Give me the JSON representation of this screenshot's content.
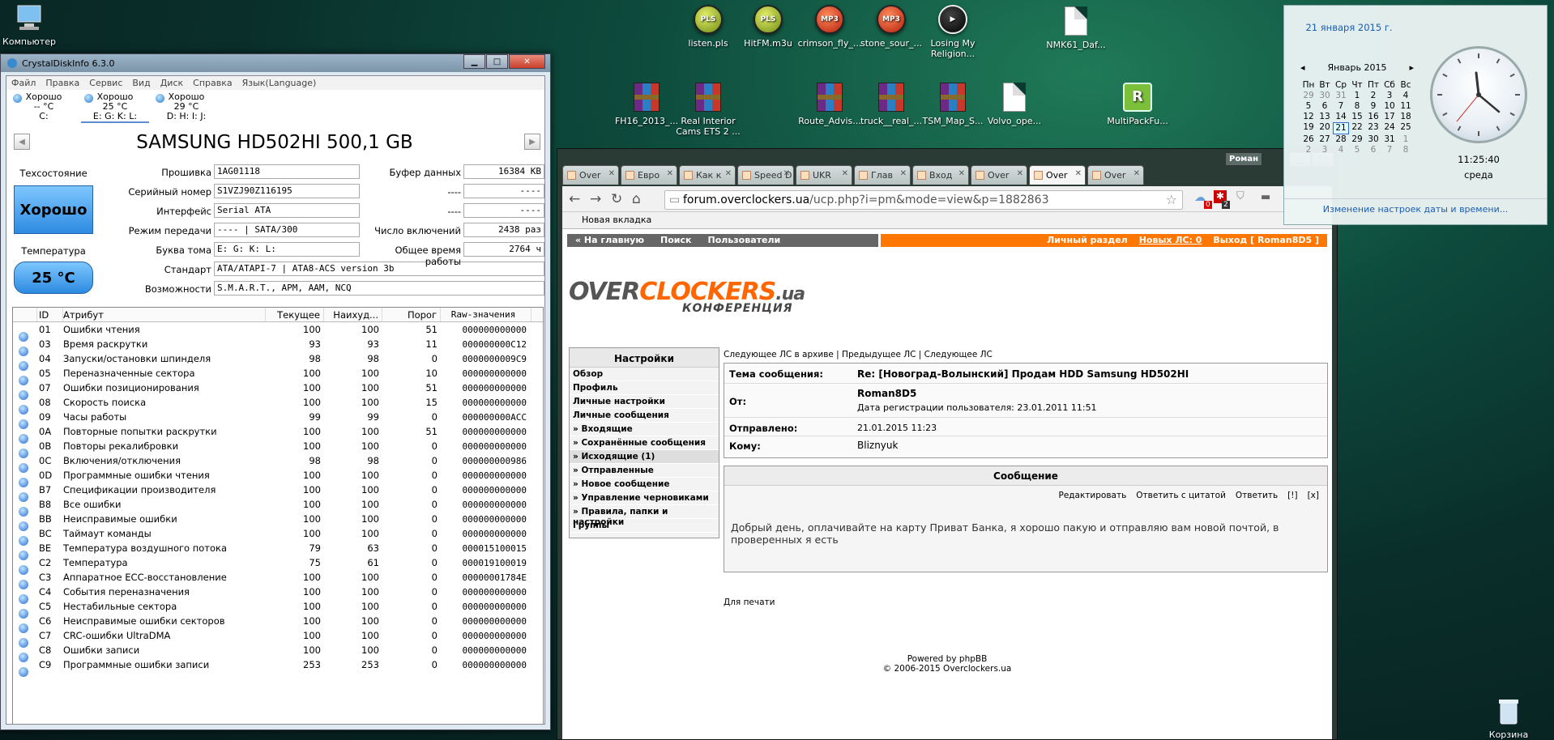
{
  "desktop_icons": [
    {
      "label": "Компьютер",
      "kind": "computer"
    },
    {
      "label": "listen.pls",
      "kind": "pls"
    },
    {
      "label": "HitFM.m3u",
      "kind": "pls"
    },
    {
      "label": "crimson_fly_...",
      "kind": "mp3"
    },
    {
      "label": "stone_sour_...",
      "kind": "mp3"
    },
    {
      "label": "Losing My Religion...",
      "kind": "play"
    },
    {
      "label": "NMK61_Daf...",
      "kind": "doc"
    },
    {
      "label": "FH16_2013_...",
      "kind": "rar"
    },
    {
      "label": "Real Interior Cams ETS 2 ...",
      "kind": "rar"
    },
    {
      "label": "Route_Advis...",
      "kind": "rar"
    },
    {
      "label": "truck__real_...",
      "kind": "rar"
    },
    {
      "label": "TSM_Map_S...",
      "kind": "rar"
    },
    {
      "label": "Volvo_ope...",
      "kind": "doc"
    },
    {
      "label": "MultiPackFu...",
      "kind": "app"
    },
    {
      "label": "Корзина",
      "kind": "trash"
    }
  ],
  "cdi": {
    "title": "CrystalDiskInfo 6.3.0",
    "menu": [
      "Файл",
      "Правка",
      "Сервис",
      "Вид",
      "Диск",
      "Справка",
      "Язык(Language)"
    ],
    "disks": [
      {
        "state": "Хорошо",
        "temp": "-- °C",
        "letters": "C:"
      },
      {
        "state": "Хорошо",
        "temp": "25 °C",
        "letters": "E: G: K: L:"
      },
      {
        "state": "Хорошо",
        "temp": "29 °C",
        "letters": "D: H: I: J:"
      }
    ],
    "model": "SAMSUNG HD502HI 500,1 GB",
    "health_label": "Техсостояние",
    "health_value": "Хорошо",
    "temp_label": "Температура",
    "temp_value": "25 °C",
    "fields": {
      "firmware_label": "Прошивка",
      "firmware": "1AG01118",
      "serial_label": "Серийный номер",
      "serial": "S1VZJ90Z116195",
      "interface_label": "Интерфейс",
      "interface": "Serial ATA",
      "mode_label": "Режим передачи",
      "mode": "---- | SATA/300",
      "volume_label": "Буква тома",
      "volume": "E: G: K: L:",
      "standard_label": "Стандарт",
      "standard": "ATA/ATAPI-7 | ATA8-ACS version 3b",
      "features_label": "Возможности",
      "features": "S.M.A.R.T., APM, AAM, NCQ",
      "buffer_label": "Буфер данных",
      "buffer": "16384 KB",
      "blank1_label": "----",
      "blank1": "----",
      "blank2_label": "----",
      "blank2": "----",
      "power_count_label": "Число включений",
      "power_count": "2438 раз",
      "power_hours_label": "Общее время работы",
      "power_hours": "2764 ч"
    },
    "table_headers": [
      "ID",
      "Атрибут",
      "Текущее",
      "Наихуд...",
      "Порог",
      "Raw-значения"
    ],
    "rows": [
      [
        "01",
        "Ошибки чтения",
        "100",
        "100",
        "51",
        "000000000000"
      ],
      [
        "03",
        "Время раскрутки",
        "93",
        "93",
        "11",
        "000000000C12"
      ],
      [
        "04",
        "Запуски/остановки шпинделя",
        "98",
        "98",
        "0",
        "0000000009C9"
      ],
      [
        "05",
        "Переназначенные сектора",
        "100",
        "100",
        "10",
        "000000000000"
      ],
      [
        "07",
        "Ошибки позиционирования",
        "100",
        "100",
        "51",
        "000000000000"
      ],
      [
        "08",
        "Скорость поиска",
        "100",
        "100",
        "15",
        "000000000000"
      ],
      [
        "09",
        "Часы работы",
        "99",
        "99",
        "0",
        "000000000ACC"
      ],
      [
        "0A",
        "Повторные попытки раскрутки",
        "100",
        "100",
        "51",
        "000000000000"
      ],
      [
        "0B",
        "Повторы рекалибровки",
        "100",
        "100",
        "0",
        "000000000000"
      ],
      [
        "0C",
        "Включения/отключения",
        "98",
        "98",
        "0",
        "000000000986"
      ],
      [
        "0D",
        "Программные ошибки чтения",
        "100",
        "100",
        "0",
        "000000000000"
      ],
      [
        "B7",
        "Спецификации производителя",
        "100",
        "100",
        "0",
        "000000000000"
      ],
      [
        "B8",
        "Все ошибки",
        "100",
        "100",
        "0",
        "000000000000"
      ],
      [
        "BB",
        "Неисправимые ошибки",
        "100",
        "100",
        "0",
        "000000000000"
      ],
      [
        "BC",
        "Таймаут команды",
        "100",
        "100",
        "0",
        "000000000000"
      ],
      [
        "BE",
        "Температура воздушного потока",
        "79",
        "63",
        "0",
        "000015100015"
      ],
      [
        "C2",
        "Температура",
        "75",
        "61",
        "0",
        "000019100019"
      ],
      [
        "C3",
        "Аппаратное ECC-восстановление",
        "100",
        "100",
        "0",
        "00000001784E"
      ],
      [
        "C4",
        "События переназначения",
        "100",
        "100",
        "0",
        "000000000000"
      ],
      [
        "C5",
        "Нестабильные сектора",
        "100",
        "100",
        "0",
        "000000000000"
      ],
      [
        "C6",
        "Неисправимые ошибки секторов",
        "100",
        "100",
        "0",
        "000000000000"
      ],
      [
        "C7",
        "CRC-ошибки UltraDMA",
        "100",
        "100",
        "0",
        "000000000000"
      ],
      [
        "C8",
        "Ошибки записи",
        "100",
        "100",
        "0",
        "000000000000"
      ],
      [
        "C9",
        "Программные ошибки записи",
        "253",
        "253",
        "0",
        "000000000000"
      ]
    ]
  },
  "browser": {
    "profile": "Роман",
    "tabs": [
      "Over",
      "Евро",
      "Как к",
      "Speed D",
      "UKR",
      "Глав",
      "Вход",
      "Over",
      "Over",
      "Over"
    ],
    "url_domain": "forum.overclockers.ua",
    "url_path": "/ucp.php?i=pm&mode=view&p=1882863",
    "badge1": "0",
    "badge2": "2",
    "bookmark": "Новая вкладка",
    "nav_left": [
      "« На главную",
      "Поиск",
      "Пользователи"
    ],
    "nav_right": [
      "Личный раздел",
      "Новых ЛС: 0",
      "Выход [ Roman8D5 ]"
    ],
    "logo_grey": "OVER",
    "logo_orange": "CLOCKERS",
    "logo_ua": ".ua",
    "logo_sub": "КОНФЕРЕНЦИЯ",
    "side_title": "Настройки",
    "side_items": [
      "Обзор",
      "Профиль",
      "Личные настройки",
      "Личные сообщения",
      "» Входящие",
      "» Сохранённые сообщения",
      "» Исходящие (1)",
      "» Отправленные",
      "» Новое сообщение",
      "» Управление черновиками",
      "» Правила, папки и настройки",
      "Группы"
    ],
    "msg_nav": "Следующее ЛС в архиве | Предыдущее ЛС | Следующее ЛС",
    "subject_label": "Тема сообщения:",
    "subject": "Re: [Новоград-Волынский] Продам HDD Samsung HD502HI",
    "from_label": "От:",
    "from": "Roman8D5",
    "reg": "Дата регистрации пользователя: 23.01.2011 11:51",
    "sent_label": "Отправлено:",
    "sent": "21.01.2015 11:23",
    "to_label": "Кому:",
    "to": "Bliznyuk",
    "message_title": "Сообщение",
    "actions": [
      "Редактировать",
      "Ответить с цитатой",
      "Ответить",
      "[!]",
      "[x]"
    ],
    "message_text": "Добрый день, оплачивайте на карту Приват Банка, я хорошо пакую и отправляю вам новой почтой, в проверенных я есть",
    "print": "Для печати",
    "footer1": "Powered by phpBB",
    "footer2": "© 2006-2015 Overclockers.ua"
  },
  "calendar": {
    "date": "21 января 2015 г.",
    "month": "Январь 2015",
    "weekdays": [
      "Пн",
      "Вт",
      "Ср",
      "Чт",
      "Пт",
      "Сб",
      "Вс"
    ],
    "days": [
      "29",
      "30",
      "31",
      "1",
      "2",
      "3",
      "4",
      "5",
      "6",
      "7",
      "8",
      "9",
      "10",
      "11",
      "12",
      "13",
      "14",
      "15",
      "16",
      "17",
      "18",
      "19",
      "20",
      "21",
      "22",
      "23",
      "24",
      "25",
      "26",
      "27",
      "28",
      "29",
      "30",
      "31",
      "1",
      "2",
      "3",
      "4",
      "5",
      "6",
      "7",
      "8"
    ],
    "time": "11:25:40",
    "weekday": "среда",
    "link": "Изменение настроек даты и времени..."
  }
}
